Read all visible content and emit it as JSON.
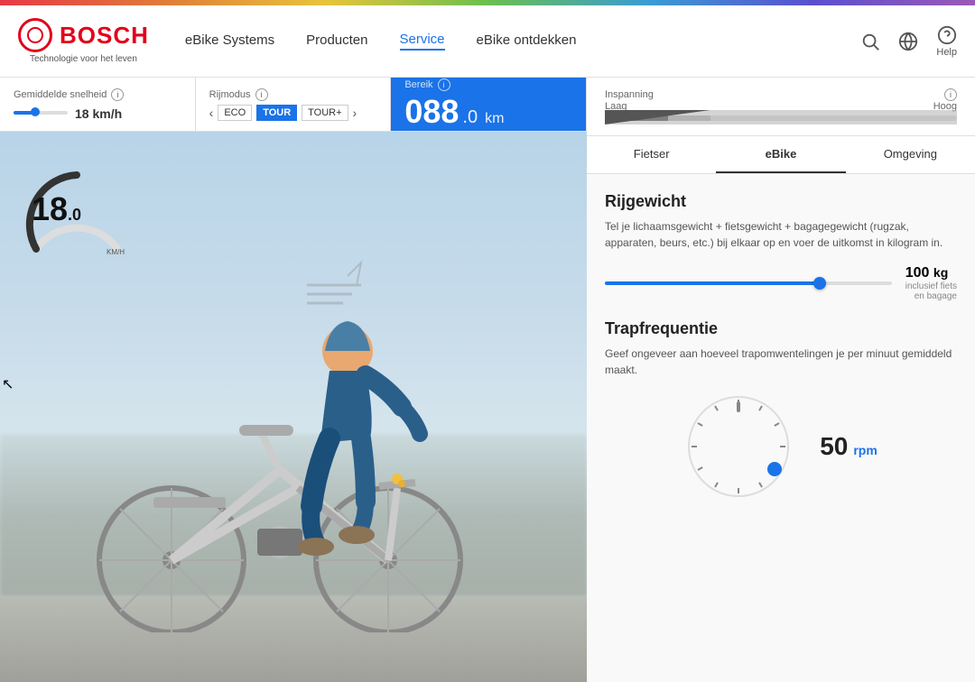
{
  "brand": {
    "name": "BOSCH",
    "tagline": "Technologie voor het leven"
  },
  "nav": {
    "items": [
      {
        "label": "eBike Systems",
        "active": false
      },
      {
        "label": "Producten",
        "active": false
      },
      {
        "label": "Service",
        "active": true
      },
      {
        "label": "eBike ontdekken",
        "active": false
      }
    ],
    "help_label": "Help"
  },
  "stats": {
    "gemiddelde_snelheid": {
      "label": "Gemiddelde snelheid",
      "value": "18 km/h"
    },
    "rijmodus": {
      "label": "Rijmodus",
      "modes": [
        "ECO",
        "TOUR",
        "TOUR+"
      ]
    },
    "bereik": {
      "label": "Bereik",
      "value_main": "088",
      "value_decimal": ".0",
      "unit": "km"
    },
    "inspanning": {
      "label": "Inspanning",
      "min": "Laag",
      "max": "Hoog"
    }
  },
  "speedometer": {
    "value": "18",
    "decimal": ".0",
    "unit": "KM/H"
  },
  "tabs": [
    {
      "label": "Fietser",
      "active": false
    },
    {
      "label": "eBike",
      "active": true
    },
    {
      "label": "Omgeving",
      "active": false
    }
  ],
  "rijgewicht": {
    "title": "Rijgewicht",
    "description": "Tel je lichaamsgewicht + fietsgewicht + bagagegewicht (rugzak, apparaten, beurs, etc.) bij elkaar op en voer de uitkomst in kilogram in.",
    "value": "100",
    "unit": "kg",
    "sub_label": "inclusief fiets en bagage",
    "slider_percent": 75
  },
  "trapfrequentie": {
    "title": "Trapfrequentie",
    "description": "Geef ongeveer aan hoeveel trapomwentelingen je per minuut gemiddeld maakt.",
    "value": "50",
    "unit": "rpm"
  }
}
